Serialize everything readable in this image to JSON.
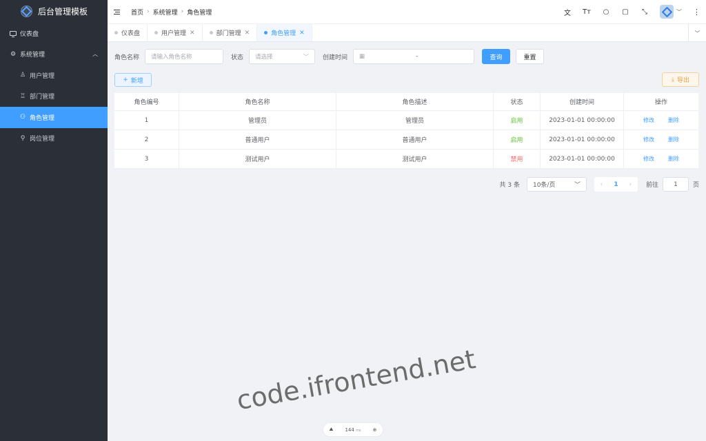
{
  "app": {
    "title": "后台管理模板"
  },
  "sidebar": {
    "items": [
      {
        "label": "仪表盘",
        "icon": "monitor-icon"
      },
      {
        "label": "系统管理",
        "icon": "gear-icon",
        "expanded": true
      },
      {
        "label": "用户管理",
        "icon": "user-icon"
      },
      {
        "label": "部门管理",
        "icon": "department-icon"
      },
      {
        "label": "角色管理",
        "icon": "role-icon",
        "active": true
      },
      {
        "label": "岗位管理",
        "icon": "post-icon"
      }
    ]
  },
  "header": {
    "breadcrumb": [
      "首页",
      "系统管理",
      "角色管理"
    ]
  },
  "tabs": [
    {
      "label": "仪表盘"
    },
    {
      "label": "用户管理"
    },
    {
      "label": "部门管理"
    },
    {
      "label": "角色管理",
      "active": true
    }
  ],
  "search": {
    "role_name_label": "角色名称",
    "role_name_placeholder": "请输入角色名称",
    "status_label": "状态",
    "status_placeholder": "请选择",
    "created_label": "创建时间",
    "date_separator": "-",
    "query_button": "查询",
    "reset_button": "重置"
  },
  "actions": {
    "add_button": "新增",
    "export_button": "导出"
  },
  "table": {
    "headers": [
      "角色编号",
      "角色名称",
      "角色描述",
      "状态",
      "创建时间",
      "操作"
    ],
    "rows": [
      {
        "id": "1",
        "name": "管理员",
        "desc": "管理员",
        "status": "启用",
        "created": "2023-01-01 00:00:00"
      },
      {
        "id": "2",
        "name": "普通用户",
        "desc": "普通用户",
        "status": "启用",
        "created": "2023-01-01 00:00:00"
      },
      {
        "id": "3",
        "name": "测试用户",
        "desc": "测试用户",
        "status": "禁用",
        "created": "2023-01-01 00:00:00"
      }
    ],
    "edit_label": "修改",
    "delete_label": "删除"
  },
  "pagination": {
    "total_text": "共 3 条",
    "page_size": "10条/页",
    "current_page": "1",
    "goto_label": "前往",
    "goto_value": "1",
    "page_unit": "页"
  },
  "watermark": "code.ifrontend.net",
  "perf": {
    "value": "144",
    "unit": "ms"
  },
  "colors": {
    "primary": "#409eff",
    "success": "#67c23a",
    "danger": "#f56c6c",
    "warning": "#e6a23c",
    "sidebar_bg": "#2b3038"
  }
}
